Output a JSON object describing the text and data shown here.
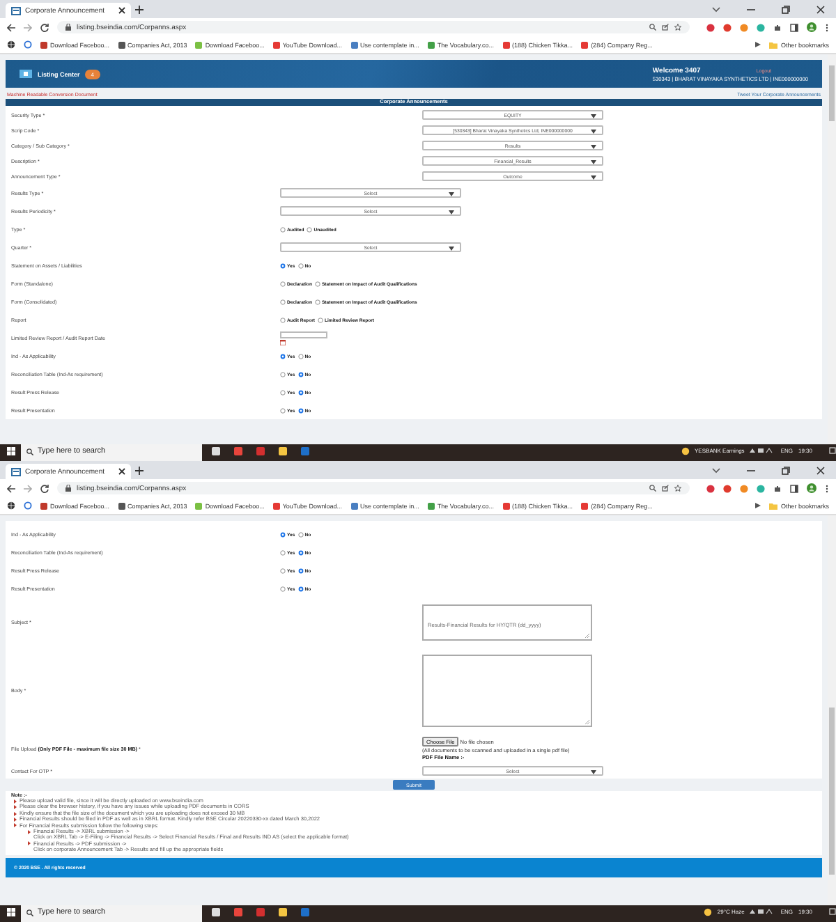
{
  "screens": [
    {
      "browser": {
        "tab_title": "Corporate Announcement",
        "url": "listing.bseindia.com/Corpanns.aspx",
        "bookmarks": [
          "Download Faceboo...",
          "Companies Act, 2013",
          "Download Faceboo...",
          "YouTube Download...",
          "Use contemplate in...",
          "The Vocabulary.co...",
          "(188) Chicken Tikka...",
          "(284) Company Reg..."
        ],
        "other_bookmarks": "Other bookmarks"
      },
      "page": {
        "banner": {
          "title": "Listing Center",
          "badge": "4",
          "welcome": "Welcome 3407",
          "logout": "Logout",
          "company": "530343 | BHARAT VINAYAKA SYNTHETICS LTD | INE000000000"
        },
        "top_links": {
          "left": "Machine Readable Conversion Document",
          "right": "Tweet Your Corporate Announcements"
        },
        "section_title": "Corporate Announcements",
        "rows": [
          {
            "label": "Security Type *",
            "kind": "select-right",
            "value": "EQUITY"
          },
          {
            "label": "Scrip Code *",
            "kind": "select-right",
            "value": "[530343] Bharat Vinayaka Synthetics Ltd, INE000000000"
          },
          {
            "label": "Category / Sub Category *",
            "kind": "select-right",
            "value": "Results"
          },
          {
            "label": "Description *",
            "kind": "select-right",
            "value": "Financial_Results"
          },
          {
            "label": "Announcement Type *",
            "kind": "select-right",
            "value": "Outcome"
          },
          {
            "label": "Results Type *",
            "kind": "select",
            "value": "Select"
          },
          {
            "label": "Results Periodicity *",
            "kind": "select",
            "value": "Select"
          },
          {
            "label": "Type *",
            "kind": "radio",
            "options": [
              {
                "label": "Audited",
                "selected": false
              },
              {
                "label": "Unaudited",
                "selected": false
              }
            ]
          },
          {
            "label": "Quarter *",
            "kind": "select",
            "value": "Select"
          },
          {
            "label": "Statement on Assets / Liabilities",
            "kind": "radio",
            "options": [
              {
                "label": "Yes",
                "selected": true
              },
              {
                "label": "No",
                "selected": false
              }
            ]
          },
          {
            "label": "Form (Standalone)",
            "kind": "radio",
            "options": [
              {
                "label": "Declaration",
                "selected": false
              },
              {
                "label": "Statement on Impact of Audit Qualifications",
                "selected": false
              }
            ]
          },
          {
            "label": "Form (Consolidated)",
            "kind": "radio",
            "options": [
              {
                "label": "Declaration",
                "selected": false
              },
              {
                "label": "Statement on Impact of Audit Qualifications",
                "selected": false
              }
            ]
          },
          {
            "label": "Report",
            "kind": "radio",
            "options": [
              {
                "label": "Audit Report",
                "selected": false
              },
              {
                "label": "Limited Review Report",
                "selected": false
              }
            ]
          },
          {
            "label": "Limited Review Report / Audit Report Date",
            "kind": "date"
          },
          {
            "label": "Ind - As Applicability",
            "kind": "radio",
            "options": [
              {
                "label": "Yes",
                "selected": true
              },
              {
                "label": "No",
                "selected": false
              }
            ]
          },
          {
            "label": "Reconciliation Table (Ind-As requirement)",
            "kind": "radio",
            "options": [
              {
                "label": "Yes",
                "selected": false
              },
              {
                "label": "No",
                "selected": true
              }
            ]
          },
          {
            "label": "Result Press Release",
            "kind": "radio",
            "options": [
              {
                "label": "Yes",
                "selected": false
              },
              {
                "label": "No",
                "selected": true
              }
            ]
          },
          {
            "label": "Result Presentation",
            "kind": "radio",
            "options": [
              {
                "label": "Yes",
                "selected": false
              },
              {
                "label": "No",
                "selected": true
              }
            ]
          }
        ]
      },
      "taskbar": {
        "search": "Type here to search",
        "widget": "YESBANK Earnings",
        "language": "ENG",
        "time": "19:30"
      }
    },
    {
      "browser": {
        "tab_title": "Corporate Announcement",
        "url": "listing.bseindia.com/Corpanns.aspx",
        "bookmarks": [
          "Download Faceboo...",
          "Companies Act, 2013",
          "Download Faceboo...",
          "YouTube Download...",
          "Use contemplate in...",
          "The Vocabulary.co...",
          "(188) Chicken Tikka...",
          "(284) Company Reg..."
        ],
        "other_bookmarks": "Other bookmarks"
      },
      "page": {
        "rows": [
          {
            "label": "Ind - As Applicability",
            "kind": "radio",
            "options": [
              {
                "label": "Yes",
                "selected": true
              },
              {
                "label": "No",
                "selected": false
              }
            ]
          },
          {
            "label": "Reconciliation Table (Ind-As requirement)",
            "kind": "radio",
            "options": [
              {
                "label": "Yes",
                "selected": false
              },
              {
                "label": "No",
                "selected": true
              }
            ]
          },
          {
            "label": "Result Press Release",
            "kind": "radio",
            "options": [
              {
                "label": "Yes",
                "selected": false
              },
              {
                "label": "No",
                "selected": true
              }
            ]
          },
          {
            "label": "Result Presentation",
            "kind": "radio",
            "options": [
              {
                "label": "Yes",
                "selected": false
              },
              {
                "label": "No",
                "selected": true
              }
            ]
          },
          {
            "label": "Subject *",
            "kind": "textarea",
            "value": "Results-Financial Results for HY/QTR (dd_yyyy)"
          },
          {
            "label": "Body *",
            "kind": "textarea-large"
          },
          {
            "label": "File Upload **(Only PDF File - maximum file size 30 MB)** *",
            "kind": "file",
            "button": "Choose File",
            "status": "No file chosen",
            "hint": "(All documents to be scanned and uploaded in a single pdf file)",
            "file_name_label": "PDF File Name :-"
          },
          {
            "label": "Contact For OTP *",
            "kind": "select-right",
            "value": "Select"
          }
        ],
        "submit": "Submit",
        "notes": {
          "title": "Note :-",
          "items": [
            {
              "text": "Please upload valid file, since it will be directly uploaded on www.bseindia.com"
            },
            {
              "text": "Please clear the browser history, if you have any issues while uploading PDF documents in CORS"
            },
            {
              "text": "Kindly ensure that the file size of the document which you are uploading does not exceed 30 MB"
            },
            {
              "text": "Financial Results should be filed in PDF as well as in XBRL format. Kindly refer BSE Circular 20220330-xx dated March 30,2022"
            },
            {
              "text": "For Financial Results submission follow the following steps:",
              "children": [
                {
                  "text": "Financial Results -> XBRL submission ->",
                  "detail": "Click on XBRL Tab -> E-Filing -> Financial Results -> Select Financial Results / Final and Results IND AS (select the applicable format)"
                },
                {
                  "text": "Financial Results -> PDF submission ->",
                  "detail": "Click on corporate Announcement Tab -> Results and fill up the appropriate fields"
                }
              ]
            }
          ]
        },
        "footer": "© 2020 BSE . All rights reserved"
      },
      "taskbar": {
        "search": "Type here to search",
        "widget": "29°C Haze",
        "language": "ENG",
        "time": "19:30"
      }
    }
  ]
}
